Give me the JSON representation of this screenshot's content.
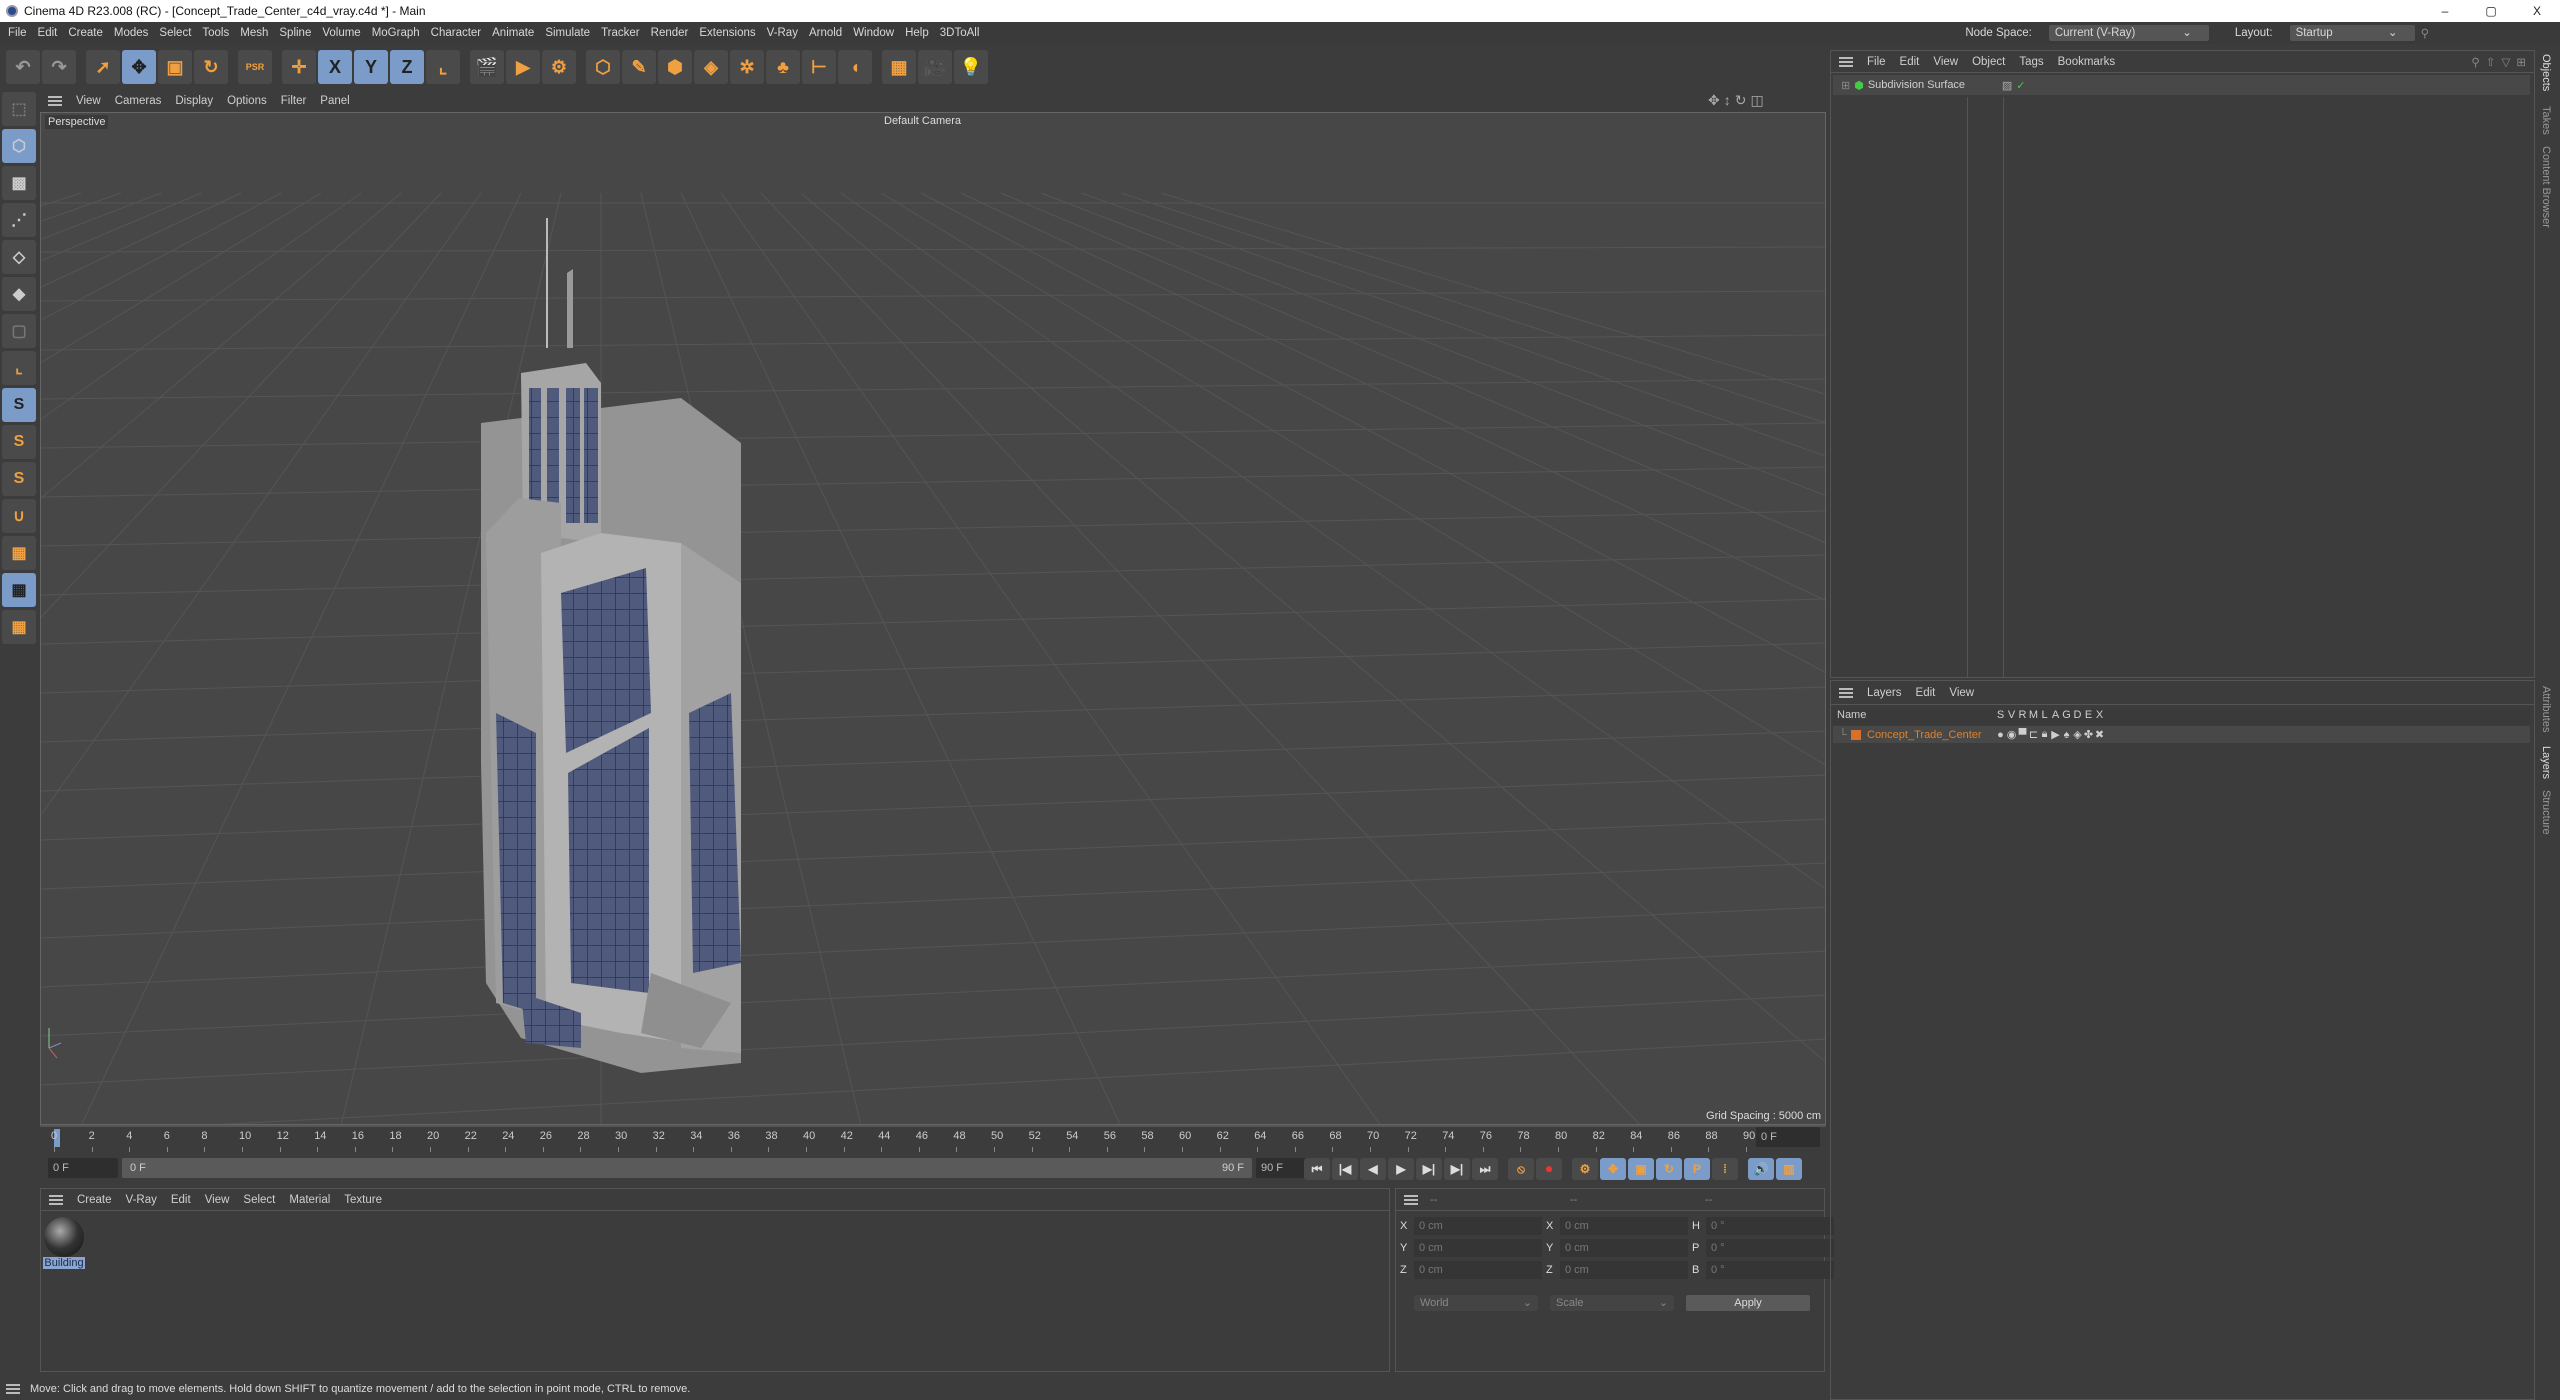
{
  "window": {
    "title": "Cinema 4D R23.008 (RC) - [Concept_Trade_Center_c4d_vray.c4d *] - Main",
    "controls": [
      "–",
      "▢",
      "X"
    ]
  },
  "menubar": {
    "items": [
      "File",
      "Edit",
      "Create",
      "Modes",
      "Select",
      "Tools",
      "Mesh",
      "Spline",
      "Volume",
      "MoGraph",
      "Character",
      "Animate",
      "Simulate",
      "Tracker",
      "Render",
      "Extensions",
      "V-Ray",
      "Arnold",
      "Window",
      "Help",
      "3DToAll"
    ],
    "node_space_label": "Node Space:",
    "node_space_value": "Current (V-Ray)",
    "layout_label": "Layout:",
    "layout_value": "Startup"
  },
  "toolbar": {
    "icons": [
      "undo-icon",
      "redo-icon",
      "live-selection-icon",
      "move-icon",
      "scale-icon",
      "rotate-icon",
      "psr-icon",
      "world-axis-icon",
      "x-axis-icon",
      "y-axis-icon",
      "z-axis-icon",
      "coordinate-system-icon",
      "render-region-icon",
      "render-view-icon",
      "render-settings-icon",
      "cube-icon",
      "pen-icon",
      "subdivision-icon",
      "extrude-icon",
      "cloner-icon",
      "mograph-icon",
      "deformer-icon",
      "spline-icon",
      "floor-icon",
      "camera-icon",
      "light-icon"
    ],
    "glyphs": [
      "↶",
      "↷",
      "➚",
      "✥",
      "▣",
      "↻",
      "PSR",
      "✛",
      "X",
      "Y",
      "Z",
      "⌞",
      "🎬",
      "▶",
      "⚙",
      "⬡",
      "✎",
      "⬢",
      "◈",
      "✲",
      "♣",
      "⊢",
      "◖",
      "▦",
      "🎥",
      "💡"
    ]
  },
  "lefttools": {
    "icons": [
      "make-editable-icon",
      "model-mode-icon",
      "texture-mode-icon",
      "points-mode-icon",
      "edges-mode-icon",
      "polygons-mode-icon",
      "uv-mode-icon",
      "axis-icon",
      "snap-icon",
      "snap-settings-icon",
      "quantize-icon",
      "magnet-icon",
      "workplane-icon",
      "locked-workplane-icon",
      "workplane-sync-icon"
    ],
    "glyphs": [
      "⬚",
      "⬡",
      "▩",
      "⋰",
      "◇",
      "◆",
      "▢",
      "⌞",
      "S",
      "S",
      "S",
      "∪",
      "▦",
      "▦",
      "▦"
    ]
  },
  "viewport": {
    "menu": [
      "View",
      "Cameras",
      "Display",
      "Options",
      "Filter",
      "Panel"
    ],
    "label": "Perspective",
    "camera": "Default Camera",
    "grid_spacing": "Grid Spacing : 5000 cm"
  },
  "timeline": {
    "ticks": [
      0,
      2,
      4,
      6,
      8,
      10,
      12,
      14,
      16,
      18,
      20,
      22,
      24,
      26,
      28,
      30,
      32,
      34,
      36,
      38,
      40,
      42,
      44,
      46,
      48,
      50,
      52,
      54,
      56,
      58,
      60,
      62,
      64,
      66,
      68,
      70,
      72,
      74,
      76,
      78,
      80,
      82,
      84,
      86,
      88,
      90
    ],
    "current": "0 F",
    "start": "0 F",
    "range_start": "0 F",
    "range_end": "90 F",
    "end": "90 F"
  },
  "playback": {
    "icons": [
      "go-start-icon",
      "prev-key-icon",
      "prev-frame-icon",
      "play-icon",
      "next-frame-icon",
      "next-key-icon",
      "go-end-icon",
      "record-keys-icon",
      "autokey-icon",
      "keyframe-selection-icon",
      "move-key-icon",
      "scale-key-icon",
      "rotate-key-icon",
      "param-key-icon",
      "pla-key-icon",
      "sound-icon",
      "timeline-icon"
    ],
    "glyphs": [
      "⏮",
      "|◀",
      "◀",
      "▶",
      "▶|",
      "▶|",
      "⏭",
      "⦸",
      "⏺",
      "⚙",
      "✥",
      "▣",
      "↻",
      "P",
      "⁞",
      "🔊",
      "▥"
    ]
  },
  "materials": {
    "menu": [
      "Create",
      "V-Ray",
      "Edit",
      "View",
      "Select",
      "Material",
      "Texture"
    ],
    "items": [
      {
        "name": "Building"
      }
    ]
  },
  "coordinates": {
    "headers": [
      "--",
      "--",
      "--"
    ],
    "rows": [
      {
        "a": "X",
        "av": "0 cm",
        "b": "X",
        "bv": "0 cm",
        "c": "H",
        "cv": "0 °"
      },
      {
        "a": "Y",
        "av": "0 cm",
        "b": "Y",
        "bv": "0 cm",
        "c": "P",
        "cv": "0 °"
      },
      {
        "a": "Z",
        "av": "0 cm",
        "b": "Z",
        "bv": "0 cm",
        "c": "B",
        "cv": "0 °"
      }
    ],
    "space": "World",
    "mode": "Scale",
    "apply": "Apply"
  },
  "status": {
    "text": "Move: Click and drag to move elements. Hold down SHIFT to quantize movement / add to the selection in point mode, CTRL to remove."
  },
  "objects": {
    "menu": [
      "File",
      "Edit",
      "View",
      "Object",
      "Tags",
      "Bookmarks"
    ],
    "items": [
      {
        "name": "Subdivision Surface"
      }
    ]
  },
  "layers": {
    "menu": [
      "Layers",
      "Edit",
      "View"
    ],
    "columns": [
      "Name",
      "S",
      "V",
      "R",
      "M",
      "L",
      "A",
      "G",
      "D",
      "E",
      "X"
    ],
    "items": [
      {
        "name": "Concept_Trade_Center",
        "color": "#d9702a"
      }
    ]
  },
  "side_tabs": [
    "Objects",
    "Takes",
    "Content Browser",
    "Attributes",
    "Layers",
    "Structure"
  ],
  "colors": {
    "accent": "#7b9cc9",
    "orange": "#f0a040",
    "glass": "#505a7c",
    "facade": "#a9a9a9"
  }
}
